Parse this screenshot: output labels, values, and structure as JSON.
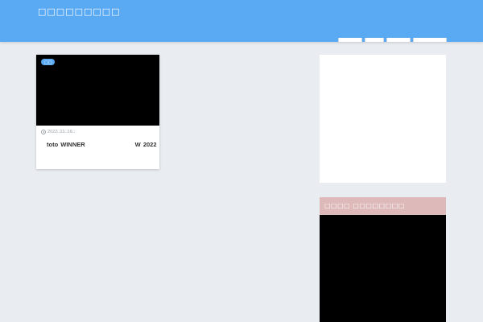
{
  "header": {
    "site_title": "□□□□□□□□□",
    "nav_items": [
      "",
      "",
      "",
      ""
    ],
    "background_color": "#59a9f3"
  },
  "main": {
    "posts": [
      {
        "category": "□□",
        "date": "2022□11□16□",
        "title_left": "toto  WINNER",
        "title_right": "W  2022"
      }
    ]
  },
  "sidebar": {
    "widget_title": "□□□□ □□□□□□□□",
    "widget_header_color": "#deb9b9"
  }
}
